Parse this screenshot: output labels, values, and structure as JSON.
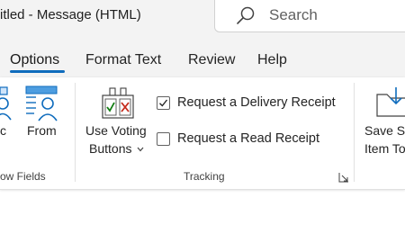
{
  "titlebar": {
    "title": "itled  -  Message (HTML)",
    "search_placeholder": "Search"
  },
  "tabs": [
    {
      "label": "Options",
      "active": true
    },
    {
      "label": "Format Text",
      "active": false
    },
    {
      "label": "Review",
      "active": false
    },
    {
      "label": "Help",
      "active": false
    }
  ],
  "ribbon": {
    "show_fields": {
      "partial_button_label": "c",
      "from_label": "From",
      "group_label": "ow Fields"
    },
    "tracking": {
      "voting_label_line1": "Use Voting",
      "voting_label_line2": "Buttons",
      "delivery_receipt_label": "Request a Delivery Receipt",
      "delivery_receipt_checked": true,
      "read_receipt_label": "Request a Read Receipt",
      "read_receipt_checked": false,
      "group_label": "Tracking"
    },
    "save_sent": {
      "label_line1": "Save Se",
      "label_line2": "Item To"
    }
  },
  "colors": {
    "accent": "#0f6cbd",
    "titlebar_bg": "#f3f3f3",
    "check_red": "#c42b1c",
    "check_green": "#107c10"
  }
}
